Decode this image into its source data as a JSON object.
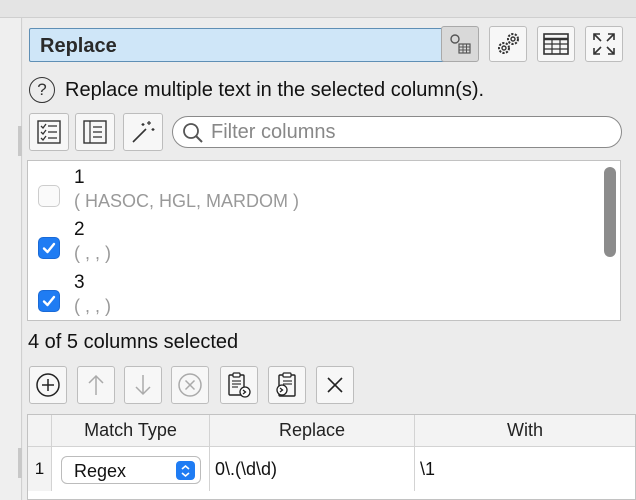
{
  "panel": {
    "title": "Replace",
    "help_text": "Replace multiple text in the selected column(s)."
  },
  "toolbar": [
    {
      "icon": "node-settings-icon"
    },
    {
      "icon": "gears-icon"
    },
    {
      "icon": "table-icon"
    },
    {
      "icon": "expand-icon"
    }
  ],
  "selection_tools": [
    {
      "icon": "checklist-icon"
    },
    {
      "icon": "list-icon"
    },
    {
      "icon": "magic-wand-icon"
    }
  ],
  "filter": {
    "placeholder": "Filter columns",
    "value": ""
  },
  "columns": [
    {
      "name": "1",
      "values": "( HASOC, HGL, MARDOM )",
      "checked": false
    },
    {
      "name": "2",
      "values": "( , ,  )",
      "checked": true
    },
    {
      "name": "3",
      "values": "( , ,  )",
      "checked": true
    }
  ],
  "status": "4 of 5 columns selected",
  "actions": [
    {
      "icon": "add-circle-icon",
      "enabled": true
    },
    {
      "icon": "arrow-up-icon",
      "enabled": false
    },
    {
      "icon": "arrow-down-icon",
      "enabled": false
    },
    {
      "icon": "remove-circle-icon",
      "enabled": false
    },
    {
      "icon": "paste-import-icon",
      "enabled": true
    },
    {
      "icon": "clipboard-export-icon",
      "enabled": true
    },
    {
      "icon": "clear-icon",
      "enabled": true
    }
  ],
  "rules_table": {
    "headers": [
      "Match Type",
      "Replace",
      "With"
    ],
    "rows": [
      {
        "num": "1",
        "match_type": "Regex",
        "replace": "0\\.(\\d\\d)",
        "with": "\\1"
      }
    ]
  },
  "colors": {
    "accent": "#1f7cf3",
    "title_bg": "#cfe6f8",
    "title_border": "#5f8fb5"
  }
}
